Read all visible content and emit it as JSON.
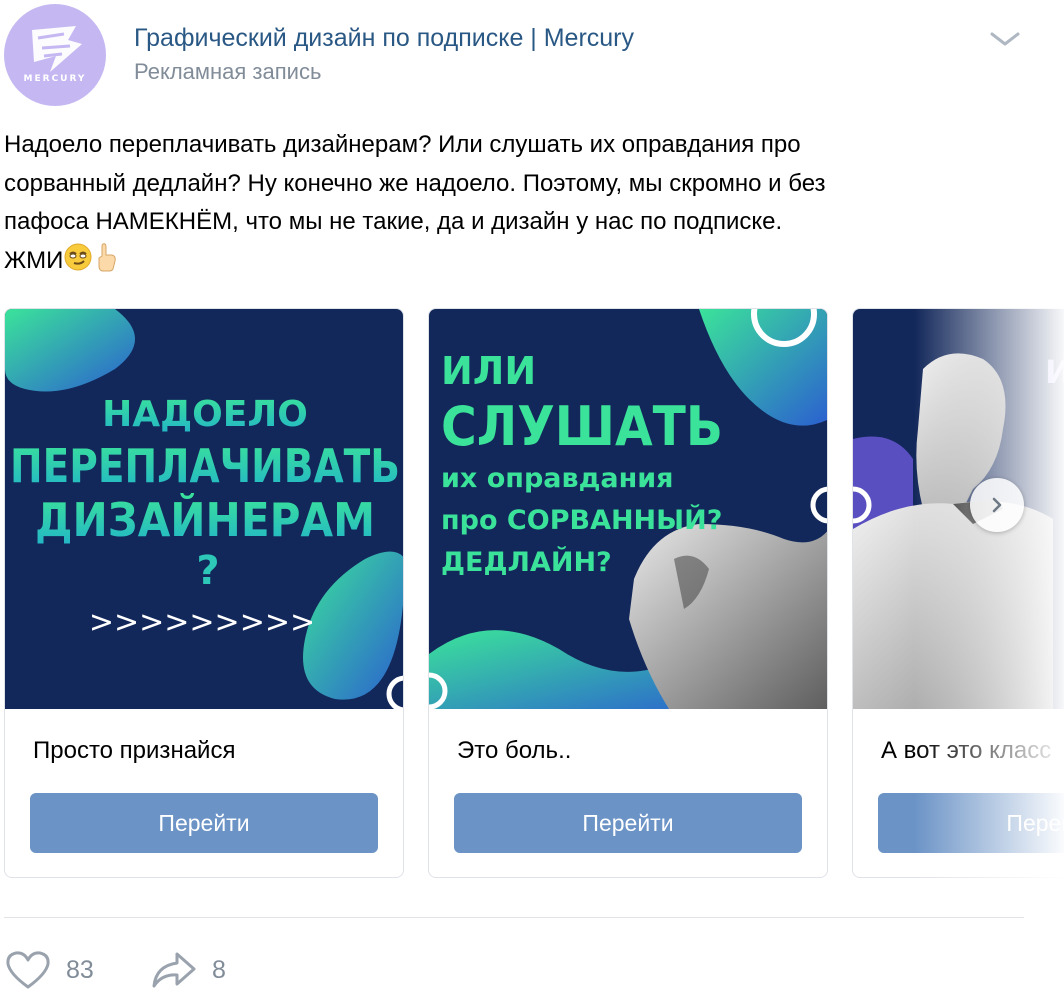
{
  "post": {
    "avatar_text": "MERCURY",
    "author": "Графический дизайн по подписке | Mercury",
    "label": "Рекламная запись",
    "text_lines": [
      "Надоело переплачивать дизайнерам? Или слушать их оправдания про",
      "сорванный дедлайн? Ну конечно же надоело. Поэтому, мы скромно и без",
      "пафоса НАМЕКНЁМ, что мы не такие, да и дизайн у нас по подписке.",
      "ЖМИ"
    ]
  },
  "cards": [
    {
      "image_lines": [
        "НАДОЕЛО",
        "ПЕРЕПЛАЧИВАТЬ",
        "ДИЗАЙНЕРАМ",
        "?",
        ">>>>>>>>>"
      ],
      "title": "Просто признайся",
      "button": "Перейти"
    },
    {
      "image_lines": [
        "ИЛИ",
        "СЛУШАТЬ",
        "их оправдания",
        "про СОРВАННЫЙ?",
        "ДЕДЛАЙН?"
      ],
      "title": "Это боль..",
      "button": "Перейти"
    },
    {
      "image_lines": [
        "И"
      ],
      "title": "А вот это класс",
      "button": "Перейти"
    }
  ],
  "actions": {
    "likes": "83",
    "shares": "8"
  },
  "colors": {
    "link": "#2a5885",
    "muted": "#818c99",
    "button": "#6b93c6",
    "banner_bg": "#12275a",
    "accent": "#3be39a"
  },
  "icons": [
    "chevron-down-icon",
    "smirk-emoji-icon",
    "pointing-up-emoji-icon",
    "chevron-right-icon",
    "heart-icon",
    "share-icon"
  ]
}
